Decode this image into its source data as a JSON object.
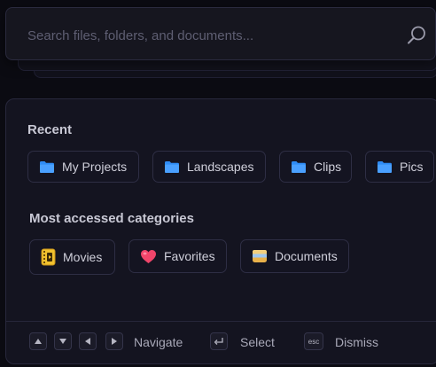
{
  "search": {
    "placeholder": "Search files, folders, and documents..."
  },
  "recent": {
    "title": "Recent",
    "items": [
      {
        "label": "My Projects",
        "icon": "folder-icon"
      },
      {
        "label": "Landscapes",
        "icon": "folder-icon"
      },
      {
        "label": "Clips",
        "icon": "folder-icon"
      },
      {
        "label": "Pics",
        "icon": "folder-icon"
      }
    ]
  },
  "categories": {
    "title": "Most accessed categories",
    "items": [
      {
        "label": "Movies",
        "icon": "movie-film-icon"
      },
      {
        "label": "Favorites",
        "icon": "heart-icon"
      },
      {
        "label": "Documents",
        "icon": "document-box-icon"
      }
    ]
  },
  "footer": {
    "navigate_label": "Navigate",
    "select_label": "Select",
    "dismiss_label": "Dismiss",
    "esc_key": "esc",
    "keys": [
      "arrow-up-key",
      "arrow-down-key",
      "arrow-left-key",
      "arrow-right-key",
      "enter-key",
      "esc-key"
    ]
  },
  "colors": {
    "background": "#0b0b12",
    "panel": "#141420",
    "folder": "#2f8cf5",
    "heart": "#f0456a",
    "film": "#f2c12e"
  }
}
